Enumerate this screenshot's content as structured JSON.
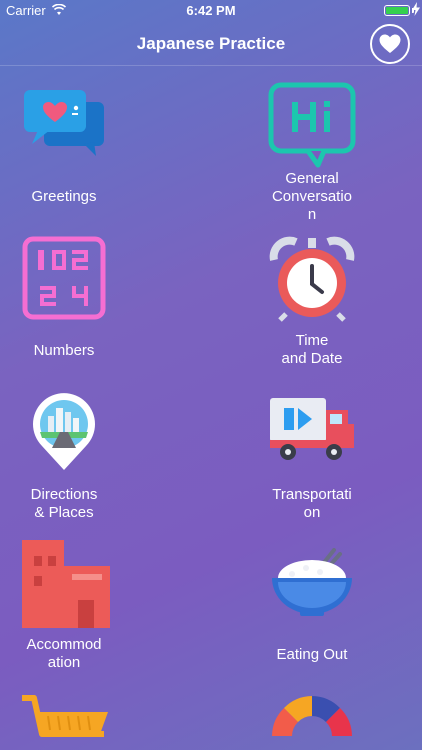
{
  "status_bar": {
    "carrier": "Carrier",
    "time": "6:42 PM"
  },
  "nav": {
    "title": "Japanese Practice",
    "favorite_icon": "heart-icon"
  },
  "categories": [
    {
      "label": "Greetings",
      "icon": "chat-bubbles-heart-icon"
    },
    {
      "label": "General\nConversatio\nn",
      "icon": "hi-speech-bubble-icon"
    },
    {
      "label": "Numbers",
      "icon": "number-grid-icon"
    },
    {
      "label": "Time\nand Date",
      "icon": "alarm-clock-icon"
    },
    {
      "label": "Directions\n& Places",
      "icon": "map-pin-city-icon"
    },
    {
      "label": "Transportati\non",
      "icon": "delivery-truck-icon"
    },
    {
      "label": "Accommod\nation",
      "icon": "buildings-icon"
    },
    {
      "label": "Eating Out",
      "icon": "rice-bowl-icon"
    },
    {
      "label": "",
      "icon": "shopping-cart-icon"
    },
    {
      "label": "",
      "icon": "gauge-icon"
    }
  ],
  "colors": {
    "background_start": "#5a78c8",
    "background_end": "#7b5cc0",
    "battery": "#35d04f"
  }
}
